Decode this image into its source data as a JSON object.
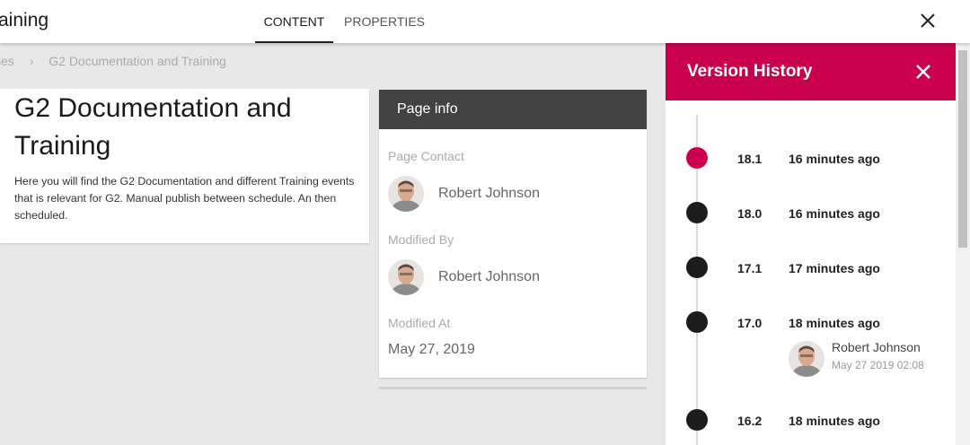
{
  "header": {
    "app_title": "aining",
    "tabs": [
      {
        "label": "CONTENT",
        "active": true
      },
      {
        "label": "PROPERTIES",
        "active": false
      }
    ],
    "close_icon": "close-icon"
  },
  "breadcrumb": {
    "items": [
      "ses",
      "G2 Documentation and Training"
    ],
    "separator": "›"
  },
  "page": {
    "title": "G2 Documentation and Training",
    "description": "Here you will find the G2 Documentation and different Training events that is relevant for G2. Manual publish between schedule. An then scheduled."
  },
  "page_info": {
    "header": "Page info",
    "contact_label": "Page Contact",
    "contact_name": "Robert Johnson",
    "modified_by_label": "Modified By",
    "modified_by_name": "Robert Johnson",
    "modified_at_label": "Modified At",
    "modified_at": "May 27, 2019"
  },
  "version_history": {
    "title": "Version History",
    "accent_color": "#c8004e",
    "versions": [
      {
        "version": "18.1",
        "when": "16 minutes ago",
        "current": true
      },
      {
        "version": "18.0",
        "when": "16 minutes ago",
        "current": false
      },
      {
        "version": "17.1",
        "when": "17 minutes ago",
        "current": false
      },
      {
        "version": "17.0",
        "when": "18 minutes ago",
        "current": false
      },
      {
        "version": "16.2",
        "when": "18 minutes ago",
        "current": false
      }
    ],
    "author": {
      "name": "Robert Johnson",
      "date": "May 27 2019 02:08"
    }
  }
}
